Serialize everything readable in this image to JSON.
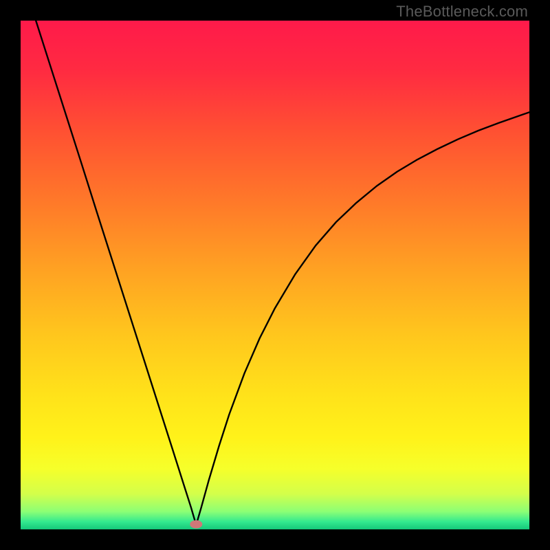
{
  "watermark": "TheBottleneck.com",
  "chart_data": {
    "type": "line",
    "title": "",
    "xlabel": "",
    "ylabel": "",
    "xlim": [
      0,
      100
    ],
    "ylim": [
      0,
      100
    ],
    "grid": false,
    "legend": false,
    "curve_color": "#000000",
    "marker": {
      "x": 34.5,
      "y": 1,
      "color": "#d07878"
    },
    "series": [
      {
        "name": "bottleneck-curve",
        "x": [
          0,
          3,
          6,
          9,
          12,
          15,
          18,
          21,
          24,
          27,
          30,
          32,
          33.5,
          34.2,
          34.5,
          34.8,
          35.5,
          37,
          39,
          41,
          44,
          47,
          50,
          54,
          58,
          62,
          66,
          70,
          74,
          78,
          82,
          86,
          90,
          94,
          98,
          100
        ],
        "y": [
          110,
          100,
          90.6,
          81.2,
          71.8,
          62.3,
          52.9,
          43.5,
          34.1,
          24.7,
          15.3,
          9,
          4.3,
          1.9,
          1,
          1.9,
          4.3,
          9.7,
          16.4,
          22.6,
          30.7,
          37.6,
          43.5,
          50.2,
          55.8,
          60.4,
          64.2,
          67.5,
          70.3,
          72.7,
          74.8,
          76.7,
          78.4,
          79.9,
          81.3,
          82
        ]
      }
    ],
    "background_gradient": {
      "stops": [
        {
          "offset": 0.0,
          "color": "#ff1a4a"
        },
        {
          "offset": 0.1,
          "color": "#ff2b41"
        },
        {
          "offset": 0.22,
          "color": "#ff5132"
        },
        {
          "offset": 0.36,
          "color": "#ff7a29"
        },
        {
          "offset": 0.5,
          "color": "#ffa522"
        },
        {
          "offset": 0.62,
          "color": "#ffc71d"
        },
        {
          "offset": 0.74,
          "color": "#ffe31a"
        },
        {
          "offset": 0.82,
          "color": "#fff21a"
        },
        {
          "offset": 0.88,
          "color": "#f6ff2a"
        },
        {
          "offset": 0.93,
          "color": "#d4ff4a"
        },
        {
          "offset": 0.965,
          "color": "#8cff75"
        },
        {
          "offset": 0.985,
          "color": "#33e98f"
        },
        {
          "offset": 1.0,
          "color": "#15c77a"
        }
      ]
    }
  }
}
